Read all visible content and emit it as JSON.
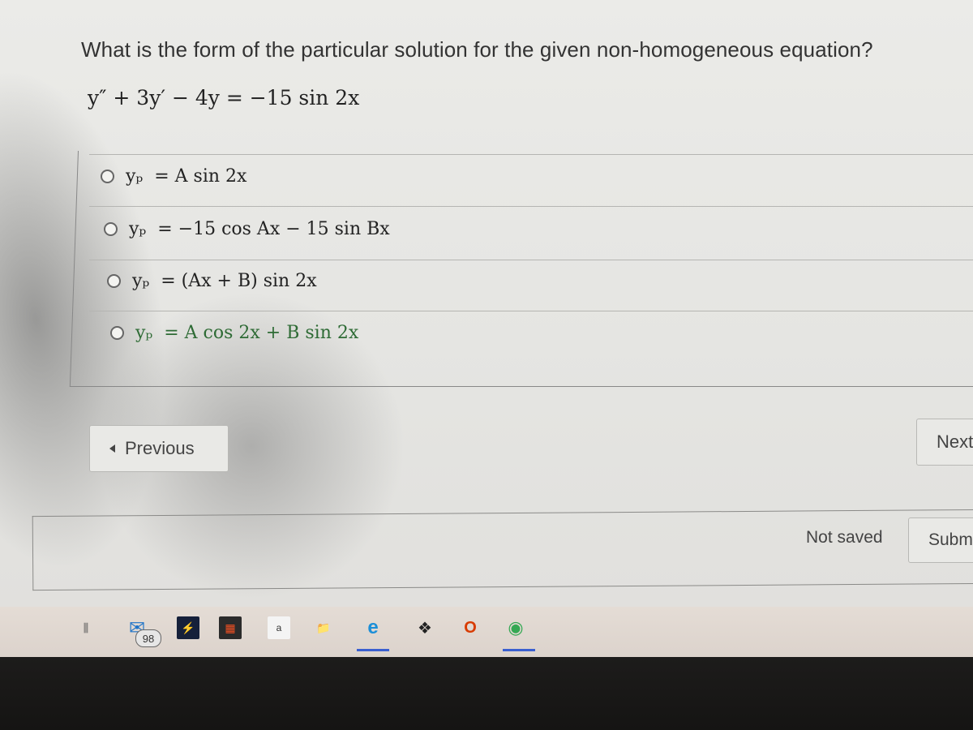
{
  "question": {
    "text": "What is the form of the particular solution for the given non-homogeneous equation?",
    "equation": "y″ + 3y′ − 4y = −15 sin 2x"
  },
  "options": [
    {
      "label": "y_p = A sin 2x",
      "lhs": "yₚ",
      "rhs": "= A sin 2x",
      "selected": false
    },
    {
      "label": "y_p = −15 cos Ax − 15 sin Bx",
      "lhs": "yₚ",
      "rhs": "= −15 cos Ax − 15 sin Bx",
      "selected": false
    },
    {
      "label": "y_p = (Ax + B) sin 2x",
      "lhs": "yₚ",
      "rhs": "= (Ax + B) sin 2x",
      "selected": false
    },
    {
      "label": "y_p = A cos 2x + B sin 2x",
      "lhs": "yₚ",
      "rhs": "= A cos 2x + B sin 2x",
      "selected": false
    }
  ],
  "navigation": {
    "previous_label": "Previous",
    "next_label": "Next"
  },
  "footer": {
    "status": "Not saved",
    "submit_label": "Submit"
  },
  "taskbar": {
    "items": [
      {
        "name": "task-view-icon",
        "glyph": "⫼"
      },
      {
        "name": "mail-icon",
        "glyph": "✉",
        "badge": "98"
      },
      {
        "name": "app-icon",
        "glyph": "⚡"
      },
      {
        "name": "store-icon",
        "glyph": "▦"
      },
      {
        "name": "amazon-icon",
        "glyph": "a"
      },
      {
        "name": "file-explorer-icon",
        "glyph": "📁"
      },
      {
        "name": "edge-icon",
        "glyph": "e"
      },
      {
        "name": "dropbox-icon",
        "glyph": "❖"
      },
      {
        "name": "office-icon",
        "glyph": "O"
      },
      {
        "name": "chrome-icon",
        "glyph": "◉"
      }
    ]
  },
  "colors": {
    "correct_option_text": "#2e6b35",
    "running_indicator": "#3a5fd0"
  }
}
